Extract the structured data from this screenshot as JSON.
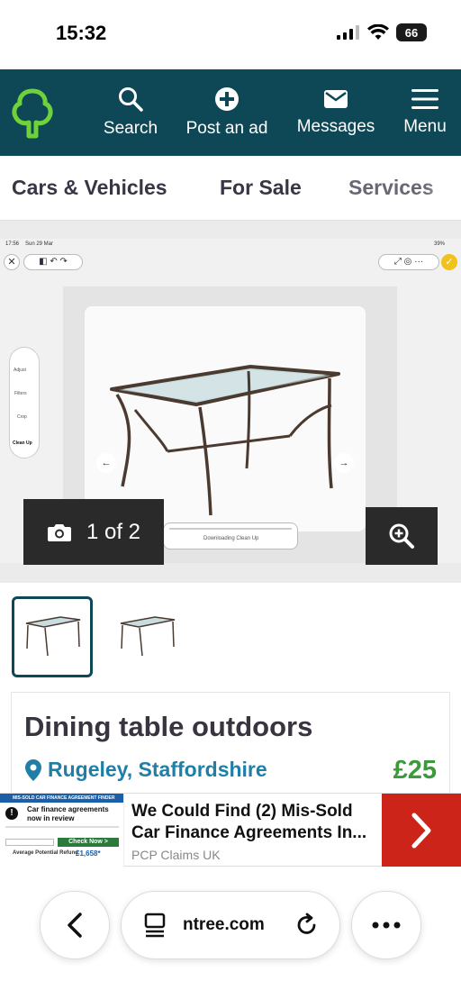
{
  "status_bar": {
    "time": "15:32",
    "battery": "66"
  },
  "header": {
    "logo_icon": "tree-icon",
    "nav": [
      {
        "label": "Search",
        "icon": "search-icon"
      },
      {
        "label": "Post an ad",
        "icon": "plus-icon"
      },
      {
        "label": "Messages",
        "icon": "mail-icon"
      },
      {
        "label": "Menu",
        "icon": "menu-icon"
      }
    ]
  },
  "categories": [
    "Cars & Vehicles",
    "For Sale",
    "Services"
  ],
  "gallery": {
    "counter": "1 of 2",
    "current_index": 1,
    "total": 2,
    "embedded_screenshot": {
      "time": "17:56",
      "date": "Sun 29 Mar",
      "battery": "39%",
      "tools": [
        "Adjust",
        "Filters",
        "Crop",
        "Clean Up"
      ],
      "downloading_text": "Downloading Clean Up"
    }
  },
  "listing": {
    "title": "Dining table outdoors",
    "location": "Rugeley, Staffordshire",
    "price": "£25"
  },
  "ad": {
    "thumb_banner": "MIS-SOLD CAR FINANCE AGREEMENT FINDER",
    "thumb_heading": "Car finance agreements now in review",
    "thumb_button": "Check Now >",
    "thumb_refund_label": "Average Potential Refund:",
    "thumb_refund_value": "£1,658*",
    "headline": "We Could Find (2) Mis-Sold Car Finance Agreements In...",
    "source": "PCP Claims UK"
  },
  "browser": {
    "url": "ntree.com"
  },
  "colors": {
    "header_bg": "#0e4856",
    "logo_green": "#6fd23a",
    "price_green": "#3c9a3c",
    "location_blue": "#1f7fa6",
    "ad_red": "#cc2418"
  }
}
